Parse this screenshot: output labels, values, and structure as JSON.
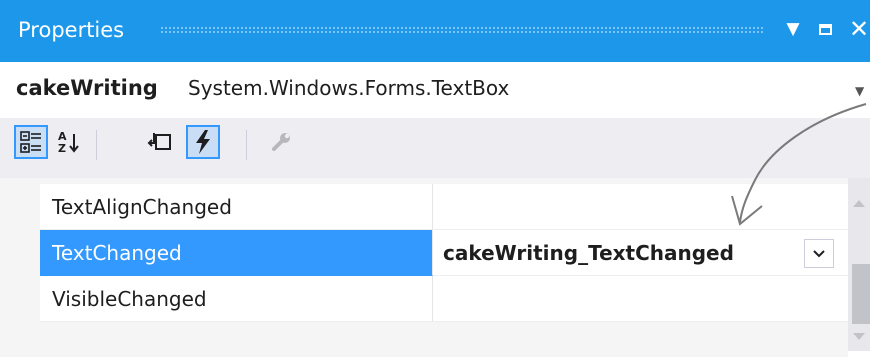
{
  "window": {
    "title": "Properties",
    "icons": {
      "pin": "dropdown-pin-icon",
      "maximize": "maximize-icon",
      "close": "close-icon"
    }
  },
  "object_selector": {
    "name": "cakeWriting",
    "type": "System.Windows.Forms.TextBox"
  },
  "toolbar": {
    "buttons": [
      {
        "icon": "categorized-icon",
        "active": true
      },
      {
        "icon": "alphabetical-icon",
        "active": false
      },
      {
        "icon": "properties-icon",
        "active": false
      },
      {
        "icon": "events-lightning-icon",
        "active": true
      },
      {
        "icon": "property-pages-wrench-icon",
        "active": false,
        "disabled": true
      }
    ]
  },
  "grid": {
    "rows": [
      {
        "name": "TextAlignChanged",
        "value": ""
      },
      {
        "name": "TextChanged",
        "value": "cakeWriting_TextChanged",
        "selected": true
      },
      {
        "name": "VisibleChanged",
        "value": ""
      }
    ]
  },
  "colors": {
    "title_bar": "#1c97ea",
    "selection": "#3399ff",
    "toolbar_bg": "#eeeef2",
    "annotation_line": "#7a7a7a"
  }
}
